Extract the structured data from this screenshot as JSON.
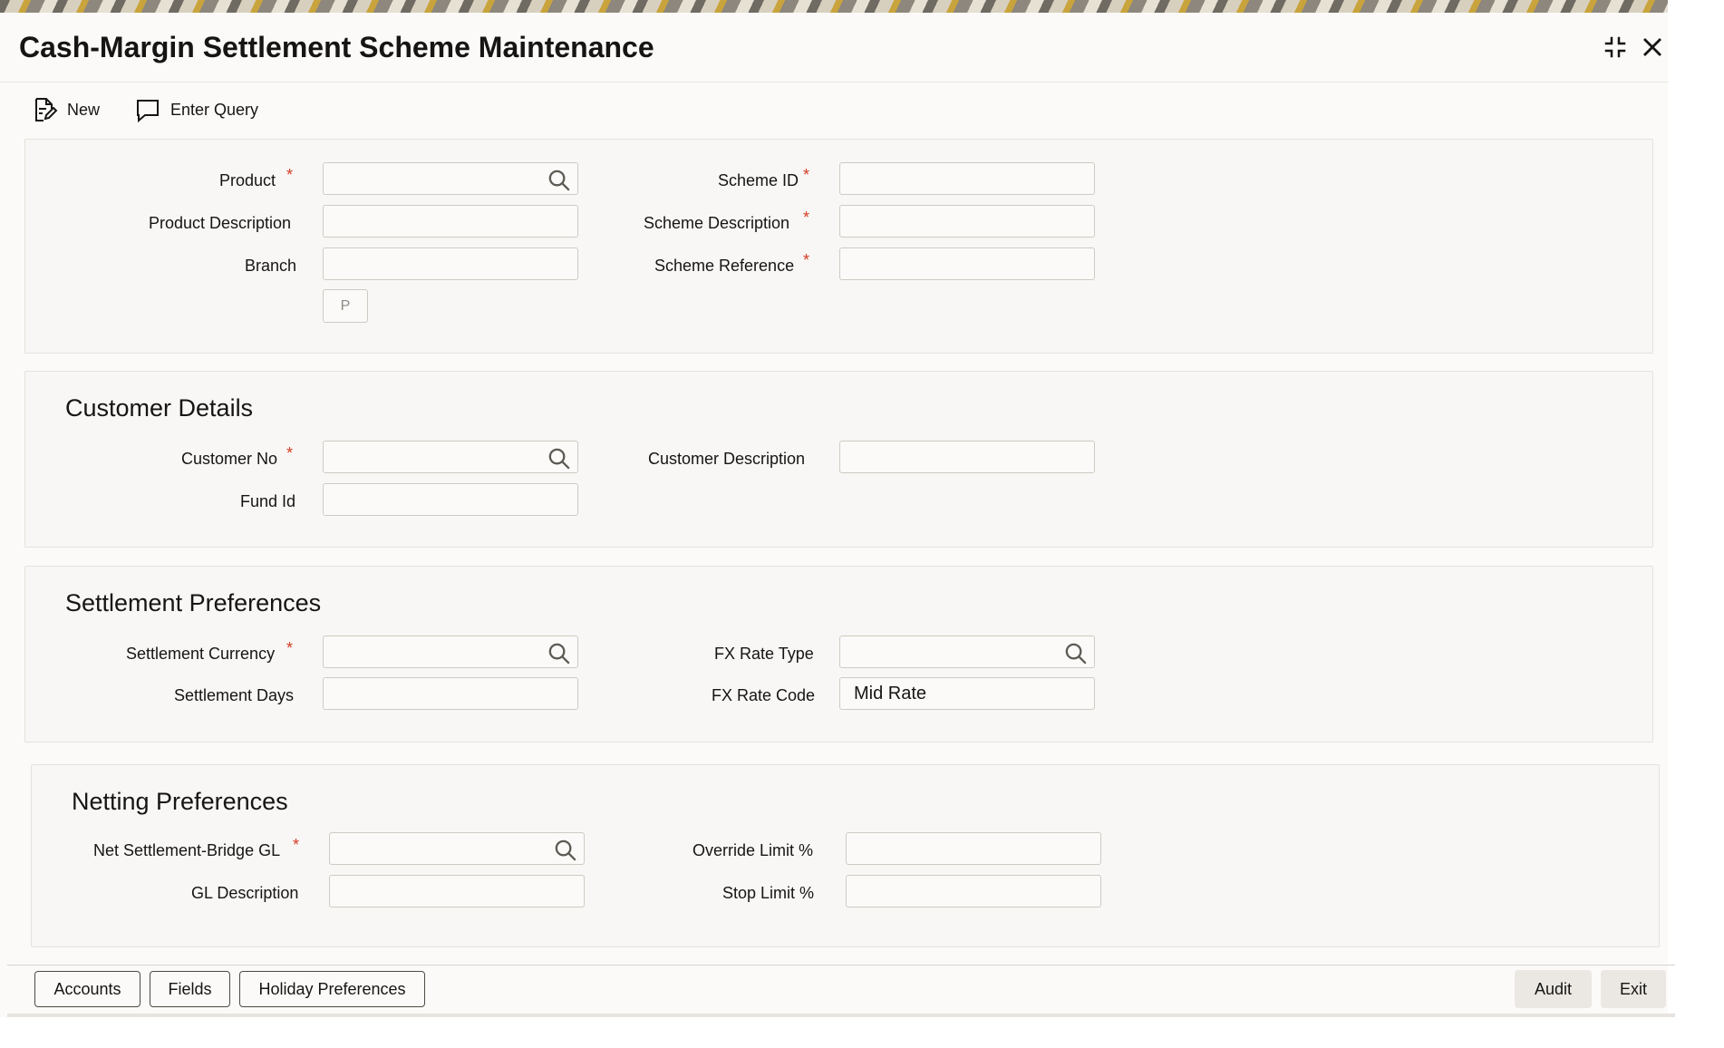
{
  "window": {
    "title": "Cash-Margin Settlement Scheme Maintenance"
  },
  "toolbar": {
    "new_label": "New",
    "enter_query_label": "Enter Query"
  },
  "main_form": {
    "product": {
      "label": "Product",
      "value": ""
    },
    "product_description": {
      "label": "Product Description",
      "value": ""
    },
    "branch": {
      "label": "Branch",
      "value": ""
    },
    "scheme_id": {
      "label": "Scheme ID",
      "value": ""
    },
    "scheme_description": {
      "label": "Scheme Description",
      "value": ""
    },
    "scheme_reference": {
      "label": "Scheme Reference",
      "value": ""
    },
    "p_button_label": "P",
    "required_marker": "*"
  },
  "customer_details": {
    "title": "Customer Details",
    "customer_no": {
      "label": "Customer No",
      "value": ""
    },
    "fund_id": {
      "label": "Fund Id",
      "value": ""
    },
    "customer_description": {
      "label": "Customer Description",
      "value": ""
    }
  },
  "settlement_preferences": {
    "title": "Settlement Preferences",
    "settlement_currency": {
      "label": "Settlement Currency",
      "value": ""
    },
    "settlement_days": {
      "label": "Settlement Days",
      "value": ""
    },
    "fx_rate_type": {
      "label": "FX Rate Type",
      "value": ""
    },
    "fx_rate_code": {
      "label": "FX Rate Code",
      "value": "Mid Rate"
    }
  },
  "netting_preferences": {
    "title": "Netting Preferences",
    "net_settlement_bridge_gl": {
      "label": "Net Settlement-Bridge GL",
      "value": ""
    },
    "gl_description": {
      "label": "GL Description",
      "value": ""
    },
    "override_limit": {
      "label": "Override Limit %",
      "value": ""
    },
    "stop_limit": {
      "label": "Stop Limit %",
      "value": ""
    }
  },
  "footer": {
    "accounts_label": "Accounts",
    "fields_label": "Fields",
    "holiday_preferences_label": "Holiday Preferences",
    "audit_label": "Audit",
    "exit_label": "Exit"
  },
  "icons": {
    "new": "document-edit-icon",
    "enter_query": "chat-bubble-icon",
    "search": "search-icon",
    "minimize": "minimize-icon",
    "close": "close-icon"
  },
  "colors": {
    "required": "#d63b25",
    "text": "#161513",
    "panel_background": "#f8f7f5"
  }
}
